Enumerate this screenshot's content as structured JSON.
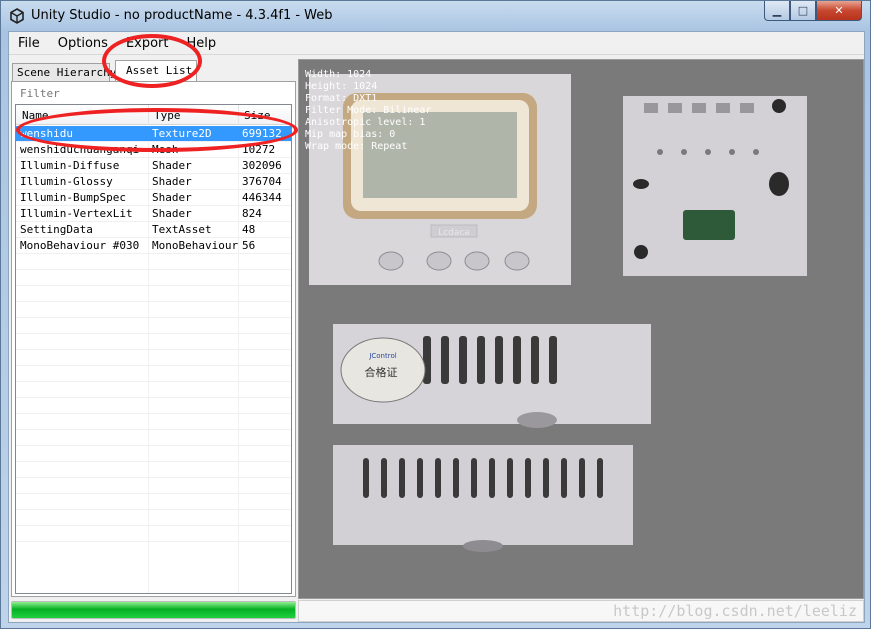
{
  "window": {
    "title": "Unity Studio - no productName - 4.3.4f1 - Web",
    "controls": {
      "minimize": "▁",
      "maximize": "□",
      "close": "✕"
    }
  },
  "menu": {
    "items": [
      "File",
      "Options",
      "Export",
      "Help"
    ]
  },
  "tabs": {
    "scene_hierarchy": "Scene Hierarchy",
    "asset_list": "Asset List"
  },
  "filter": {
    "placeholder": "Filter"
  },
  "asset_table": {
    "columns": [
      "Name",
      "Type",
      "Size"
    ],
    "rows": [
      {
        "name": "wenshidu",
        "type": "Texture2D",
        "size": "699132",
        "selected": true
      },
      {
        "name": "wenshiduchuanganqi",
        "type": "Mesh",
        "size": "10272"
      },
      {
        "name": "Illumin-Diffuse",
        "type": "Shader",
        "size": "302096"
      },
      {
        "name": "Illumin-Glossy",
        "type": "Shader",
        "size": "376704"
      },
      {
        "name": "Illumin-BumpSpec",
        "type": "Shader",
        "size": "446344"
      },
      {
        "name": "Illumin-VertexLit",
        "type": "Shader",
        "size": "824"
      },
      {
        "name": "SettingData",
        "type": "TextAsset",
        "size": "48"
      },
      {
        "name": "MonoBehaviour #030",
        "type": "MonoBehaviour",
        "size": "56"
      }
    ]
  },
  "progress": {
    "value": 1.0,
    "color": "#06b025"
  },
  "preview": {
    "info_lines": [
      "Width: 1024",
      "Height: 1024",
      "Format: DXT1",
      "Filter Mode: Bilinear",
      "Anisotropic level: 1",
      "Mip map bias: 0",
      "Wrap mode: Repeat"
    ],
    "device_label": "Lcdaca",
    "sticker_text": "合格证",
    "sticker_brand": "JControl"
  },
  "watermark": "http://blog.csdn.net/leeliz",
  "colors": {
    "selection": "#3399ff",
    "annotation": "#ee2222",
    "preview_bg": "#7a7a7a"
  }
}
